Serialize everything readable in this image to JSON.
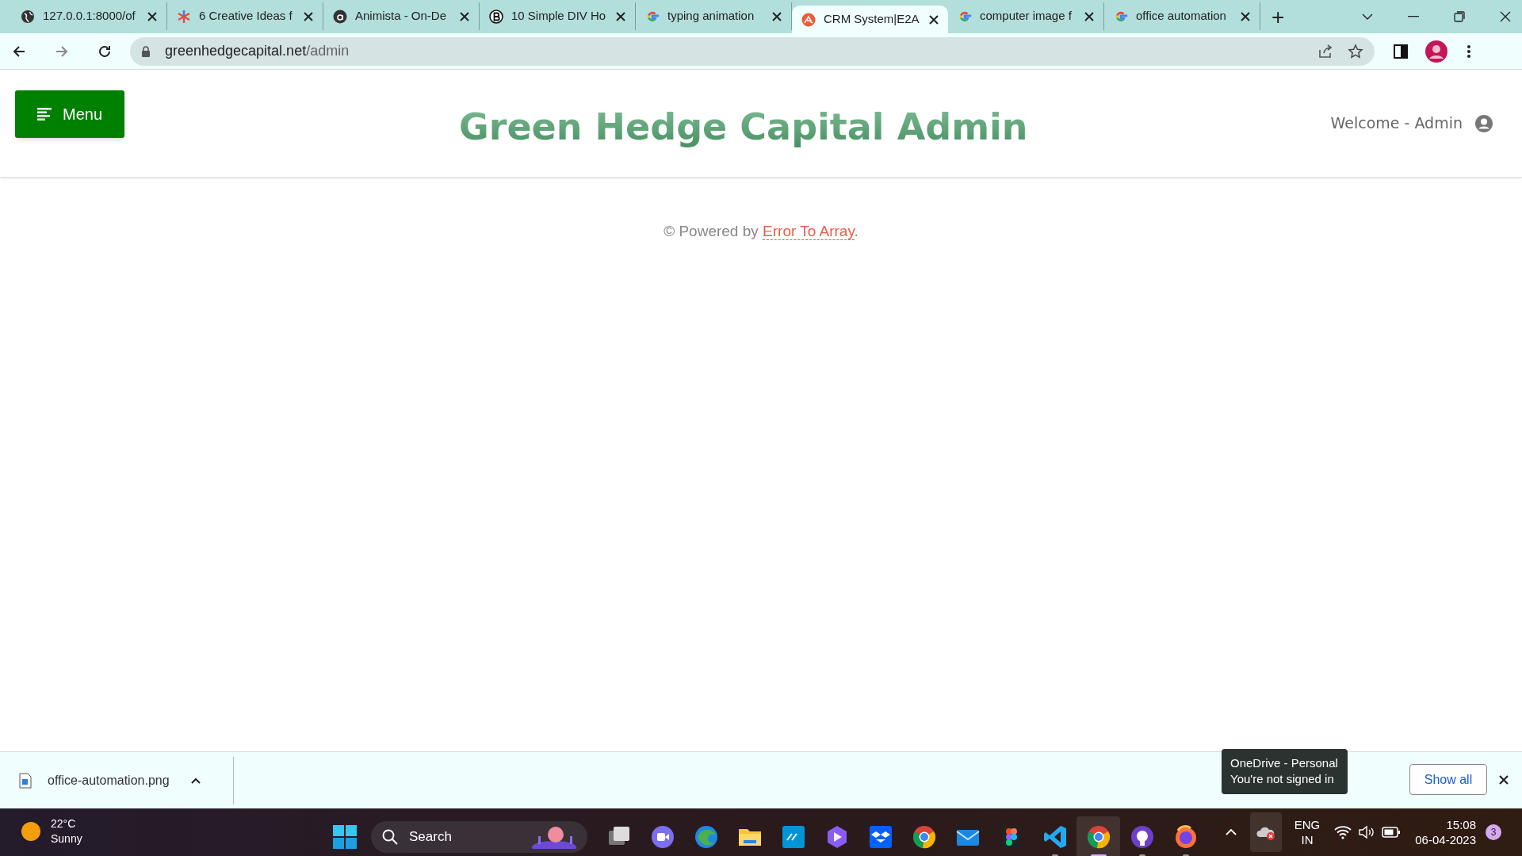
{
  "browser": {
    "tabs": [
      {
        "title": "127.0.0.1:8000/of",
        "kind": "globe",
        "selected": false
      },
      {
        "title": "6 Creative Ideas f",
        "kind": "asterisk",
        "selected": false
      },
      {
        "title": "Animista - On-De",
        "kind": "letter-a",
        "selected": false
      },
      {
        "title": "10 Simple DIV Ho",
        "kind": "letter-b",
        "selected": false
      },
      {
        "title": "typing animation",
        "kind": "google",
        "selected": false
      },
      {
        "title": "CRM System|E2A",
        "kind": "e2a",
        "selected": true
      },
      {
        "title": "computer image f",
        "kind": "google",
        "selected": false
      },
      {
        "title": "office automation",
        "kind": "google",
        "selected": false
      }
    ],
    "new_tab": "+",
    "address": {
      "host": "greenhedgecapital.net",
      "path": "/admin"
    }
  },
  "page": {
    "menu_button": "Menu",
    "title": "Green Hedge Capital Admin",
    "welcome": "Welcome - Admin",
    "footer": {
      "prefix": "© Powered by ",
      "link": "Error To Array",
      "suffix": "."
    }
  },
  "downloads": {
    "file": "office-automation.png",
    "show_all": "Show all"
  },
  "tooltip": {
    "lines": [
      "OneDrive - Personal",
      "You're not signed in"
    ]
  },
  "taskbar": {
    "weather": {
      "temp": "22°C",
      "condition": "Sunny"
    },
    "search": "Search",
    "apps": [
      {
        "kind": "files-stack",
        "running": false,
        "selected": false
      },
      {
        "kind": "meet",
        "running": false,
        "selected": false
      },
      {
        "kind": "edge",
        "running": false,
        "selected": false
      },
      {
        "kind": "folder",
        "running": false,
        "selected": false
      },
      {
        "kind": "hp",
        "running": false,
        "selected": false
      },
      {
        "kind": "copilot",
        "running": false,
        "selected": false
      },
      {
        "kind": "dropbox",
        "running": false,
        "selected": false
      },
      {
        "kind": "chrome",
        "running": false,
        "selected": false
      },
      {
        "kind": "mail",
        "running": false,
        "selected": false
      },
      {
        "kind": "figma",
        "running": false,
        "selected": false
      },
      {
        "kind": "vscode",
        "running": true,
        "selected": false
      },
      {
        "kind": "chrome",
        "running": true,
        "selected": true
      },
      {
        "kind": "github",
        "running": true,
        "selected": false
      },
      {
        "kind": "firefox",
        "running": true,
        "selected": false
      }
    ],
    "language": [
      "ENG",
      "IN"
    ],
    "time": "15:08",
    "date": "06-04-2023",
    "notifications": "3"
  }
}
